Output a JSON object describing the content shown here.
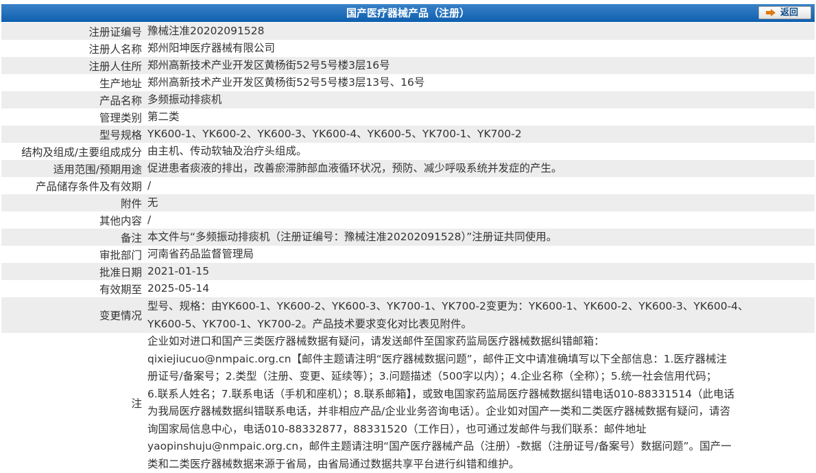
{
  "header": {
    "title": "国产医疗器械产品（注册）",
    "back_label": "返回"
  },
  "rows": [
    {
      "label": "注册证编号",
      "value": "豫械注准20202091528"
    },
    {
      "label": "注册人名称",
      "value": "郑州阳坤医疗器械有限公司"
    },
    {
      "label": "注册人住所",
      "value": "郑州高新技术产业开发区黄杨街52号5号楼3层16号"
    },
    {
      "label": "生产地址",
      "value": "郑州高新技术产业开发区黄杨街52号5号楼3层13号、16号"
    },
    {
      "label": "产品名称",
      "value": "多频振动排痰机"
    },
    {
      "label": "管理类别",
      "value": "第二类"
    },
    {
      "label": "型号规格",
      "value": "YK600-1、YK600-2、YK600-3、YK600-4、YK600-5、YK700-1、YK700-2"
    },
    {
      "label": "结构及组成/主要组成成分",
      "value": "由主机、传动软轴及治疗头组成。"
    },
    {
      "label": "适用范围/预期用途",
      "value": "促进患者痰液的排出，改善瘀滞肺部血液循环状况，预防、减少呼吸系统并发症的产生。"
    },
    {
      "label": "产品储存条件及有效期",
      "value": "/"
    },
    {
      "label": "附件",
      "value": "无"
    },
    {
      "label": "其他内容",
      "value": "/"
    },
    {
      "label": "备注",
      "value": "本文件与“多频振动排痰机（注册证编号：豫械注准20202091528）”注册证共同使用。"
    },
    {
      "label": "审批部门",
      "value": "河南省药品监督管理局"
    },
    {
      "label": "批准日期",
      "value": "2021-01-15"
    },
    {
      "label": "有效期至",
      "value": "2025-05-14"
    }
  ],
  "change": {
    "label": "变更情况",
    "lines": [
      "型号、规格：由YK600-1、YK600-2、YK600-3、YK700-1、YK700-2变更为：YK600-1、YK600-2、YK600-3、YK600-4、",
      "YK600-5、YK700-1、YK700-2。产品技术要求变化对比表见附件。"
    ]
  },
  "note": {
    "label": "注",
    "lines": [
      "企业如对进口和国产三类医疗器械数据有疑问，请发送邮件至国家药监局医疗器械数据纠错邮箱：",
      "qixiejiucuo@nmpaic.org.cn【邮件主题请注明“医疗器械数据问题”，邮件正文中请准确填写以下全部信息：1.医疗器械注",
      "册证号/备案号；2.类型（注册、变更、延续等）；3.问题描述（500字以内）；4.企业名称（全称）；5.统一社会信用代码；",
      "6.联系人姓名；7.联系电话（手机和座机）；8.联系邮箱】，或致电国家药监局医疗器械数据纠错电话010-88331514（此电话",
      "为我局医疗器械数据纠错联系电话，并非相应产品/企业业务咨询电话）。企业如对国产一类和二类医疗器械数据有疑问，请咨",
      "询国家局信息中心，电话010-88332877，88331520（工作日），也可通过发邮件与我们联系：邮件地址",
      "yaopinshuju@nmpaic.org.cn，邮件主题请注明“国产医疗器械产品（注册）-数据（注册证号/备案号）数据问题”。国产一",
      "类和二类医疗器械数据来源于省局，由省局通过数据共享平台进行纠错和维护。"
    ]
  }
}
